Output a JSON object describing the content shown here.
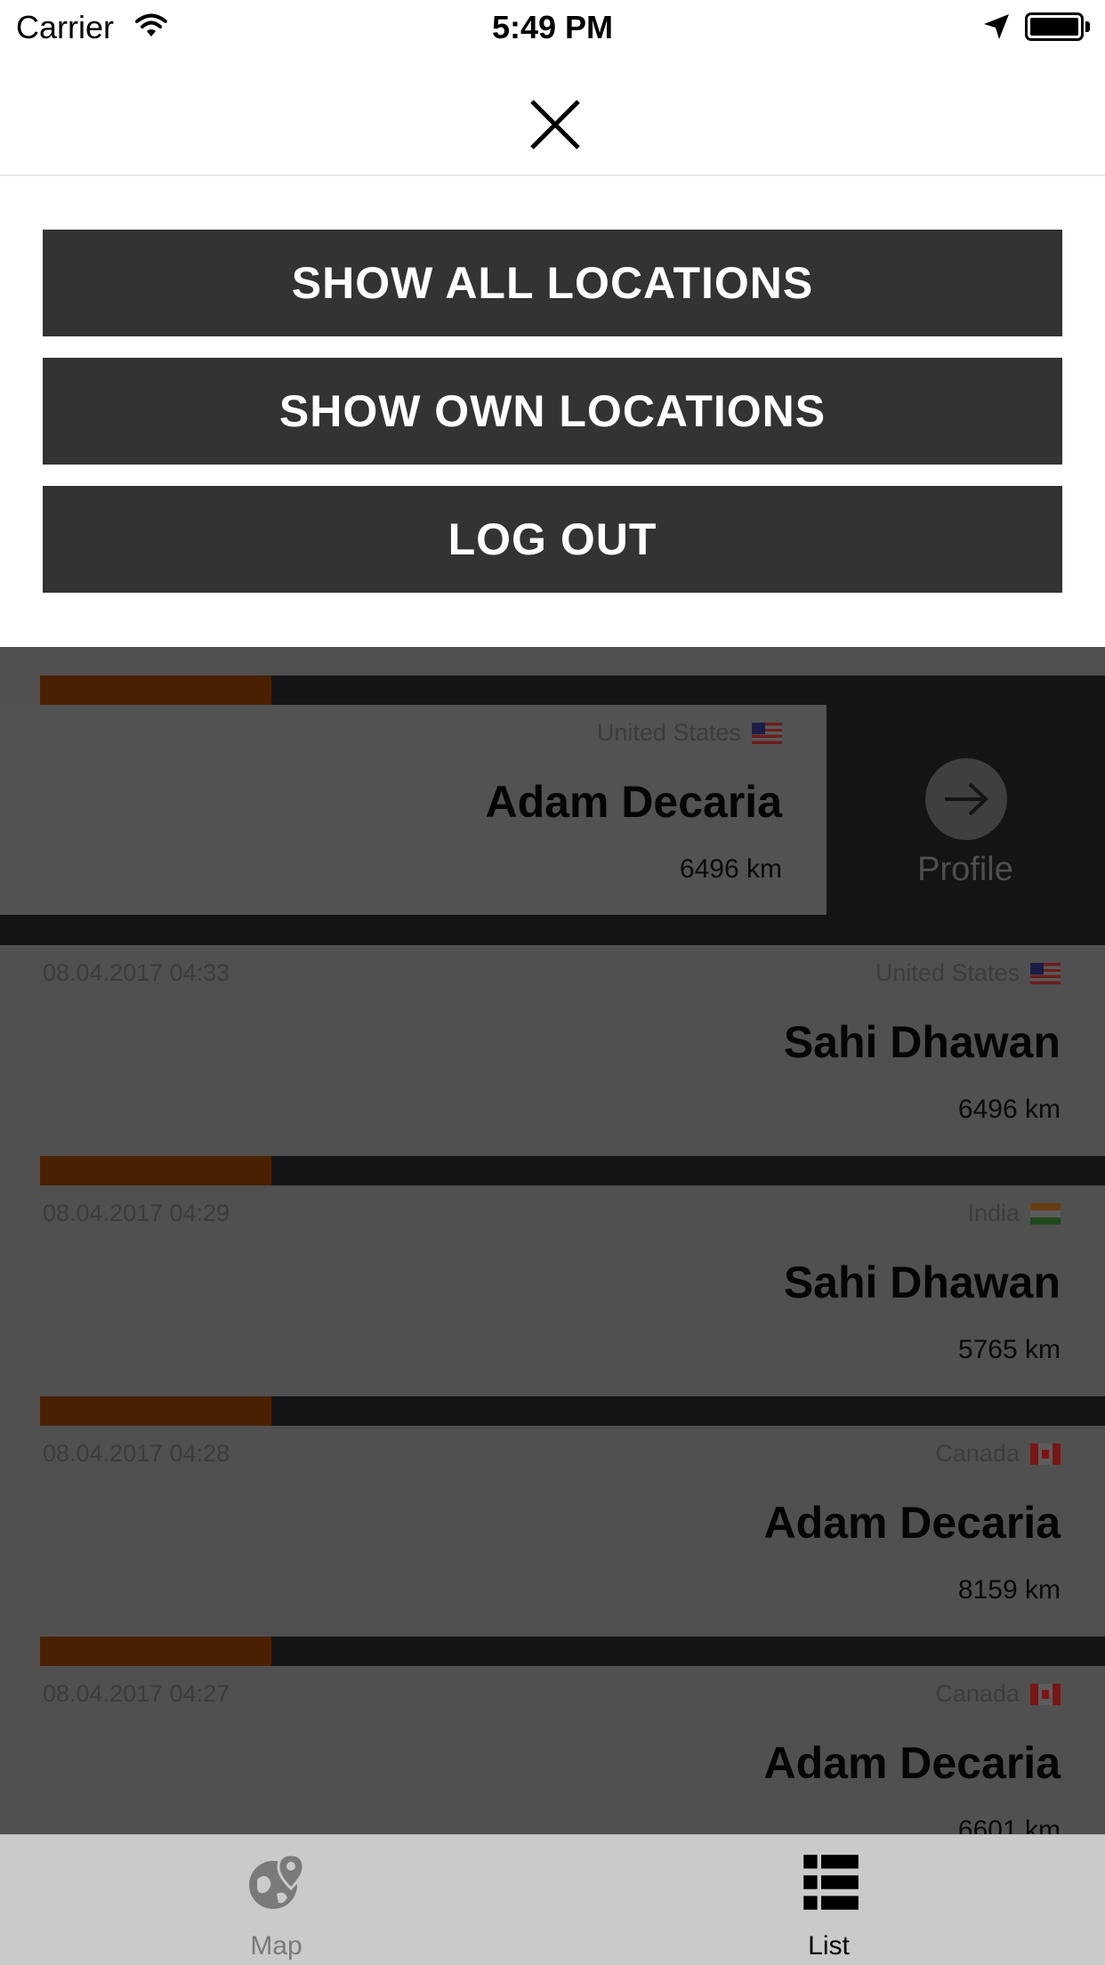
{
  "status_bar": {
    "carrier": "Carrier",
    "time": "5:49 PM"
  },
  "menu": {
    "items": [
      {
        "label": "SHOW ALL LOCATIONS"
      },
      {
        "label": "SHOW OWN LOCATIONS"
      },
      {
        "label": "LOG OUT"
      }
    ]
  },
  "swiped_row": {
    "country": "United States",
    "name": "Adam Decaria",
    "distance": "6496 km",
    "action_label": "Profile"
  },
  "entries": [
    {
      "date": "08.04.2017 04:33",
      "country": "United States",
      "name": "Sahi Dhawan",
      "distance": "6496 km"
    },
    {
      "date": "08.04.2017 04:29",
      "country": "India",
      "name": "Sahi Dhawan",
      "distance": "5765 km"
    },
    {
      "date": "08.04.2017 04:28",
      "country": "Canada",
      "name": "Adam Decaria",
      "distance": "8159 km"
    },
    {
      "date": "08.04.2017 04:27",
      "country": "Canada",
      "name": "Adam Decaria",
      "distance": "6601 km"
    }
  ],
  "tab_bar": {
    "tabs": [
      {
        "label": "Map",
        "icon": "globe-pin-icon",
        "active": false
      },
      {
        "label": "List",
        "icon": "list-icon",
        "active": true
      }
    ]
  },
  "colors": {
    "menu_button": "#333333",
    "progress_fill": "#4a2100",
    "dim_overlay": "#505050",
    "tab_active": "#000000",
    "tab_inactive": "#7a7a7a"
  }
}
